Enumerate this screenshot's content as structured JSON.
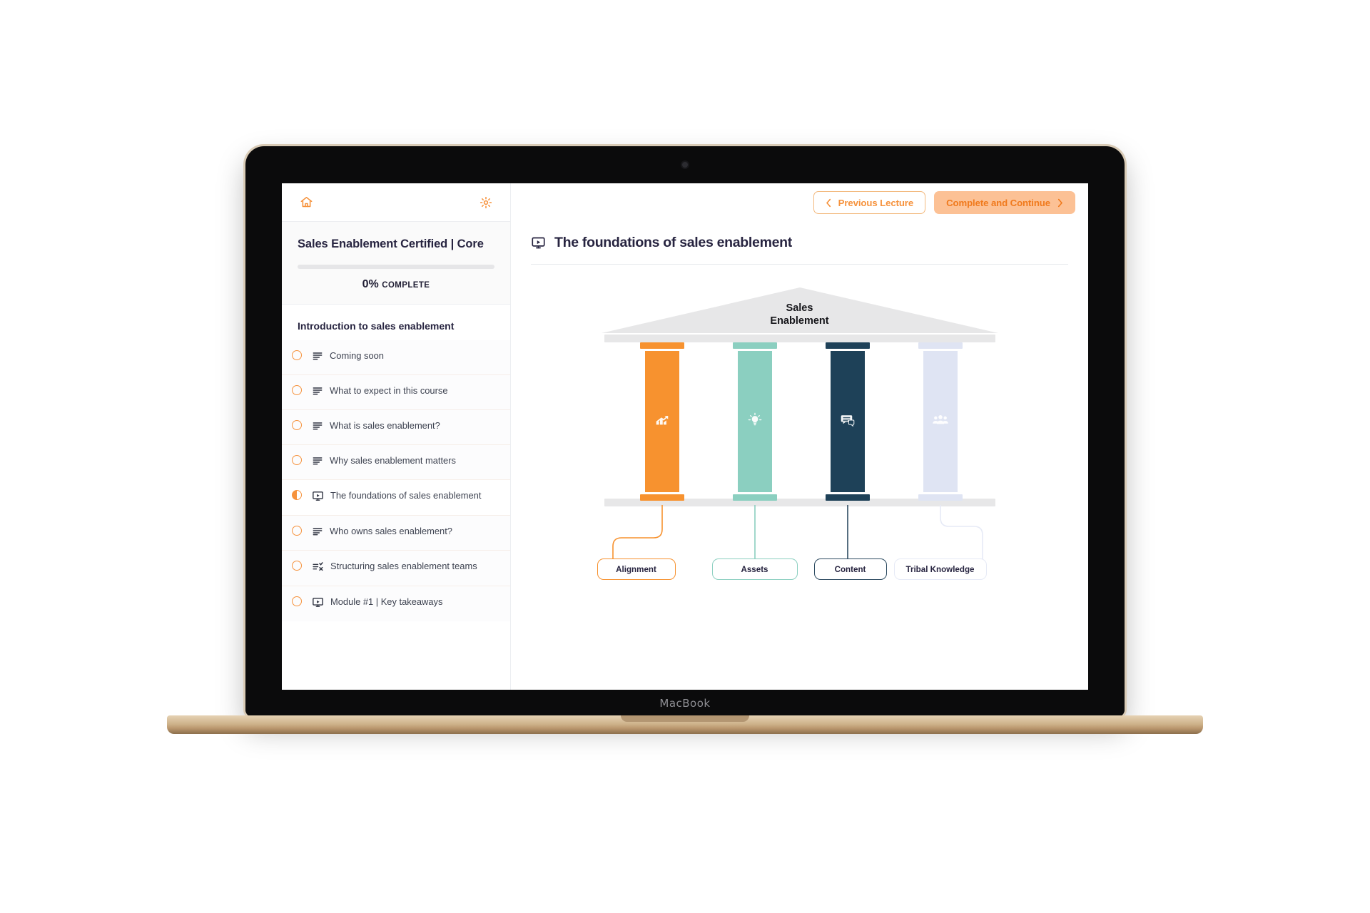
{
  "device": {
    "brand_label": "MacBook"
  },
  "sidebar": {
    "home_icon": "home-icon",
    "settings_icon": "gear-icon",
    "course": {
      "title": "Sales Enablement Certified | Core",
      "progress_percent": "0%",
      "progress_value": 0,
      "progress_label": "COMPLETE"
    },
    "section_title": "Introduction to sales enablement",
    "lessons": [
      {
        "title": "Coming soon",
        "icon": "text-lesson-icon",
        "status": "incomplete",
        "active": false
      },
      {
        "title": "What to expect in this course",
        "icon": "text-lesson-icon",
        "status": "incomplete",
        "active": false
      },
      {
        "title": "What is sales enablement?",
        "icon": "text-lesson-icon",
        "status": "incomplete",
        "active": false
      },
      {
        "title": "Why sales enablement matters",
        "icon": "text-lesson-icon",
        "status": "incomplete",
        "active": false
      },
      {
        "title": "The foundations of sales enablement",
        "icon": "video-lesson-icon",
        "status": "in-progress",
        "active": true
      },
      {
        "title": "Who owns sales enablement?",
        "icon": "text-lesson-icon",
        "status": "incomplete",
        "active": false
      },
      {
        "title": "Structuring sales enablement teams",
        "icon": "quiz-lesson-icon",
        "status": "incomplete",
        "active": false
      },
      {
        "title": "Module #1 | Key takeaways",
        "icon": "video-lesson-icon",
        "status": "incomplete",
        "active": false
      }
    ]
  },
  "toolbar": {
    "previous_label": "Previous Lecture",
    "previous_chevron": "chevron-left-icon",
    "continue_label": "Complete and Continue",
    "continue_chevron": "chevron-right-icon"
  },
  "lecture": {
    "icon": "video-lesson-icon",
    "title": "The foundations of sales enablement"
  },
  "diagram": {
    "roof_line_1": "Sales",
    "roof_line_2": "Enablement",
    "pillars": [
      {
        "label": "Alignment",
        "icon": "trending-chart-icon",
        "color": "#f7922f",
        "box_border": "#f7922f"
      },
      {
        "label": "Assets",
        "icon": "lightbulb-icon",
        "color": "#8bcfc0",
        "box_border": "#8bcfc0"
      },
      {
        "label": "Content",
        "icon": "chat-bubbles-icon",
        "color": "#1e4158",
        "box_border": "#2c4a60"
      },
      {
        "label": "Tribal Knowledge",
        "icon": "people-group-icon",
        "color": "#dfe4f3",
        "box_border": "#e6eaf6"
      }
    ],
    "structure_color": "#e7e7e8"
  },
  "colors": {
    "accent": "#f6923c",
    "accent_soft": "#fcc195",
    "ink": "#272440",
    "muted": "#3d4250",
    "divider": "#eceef1"
  }
}
